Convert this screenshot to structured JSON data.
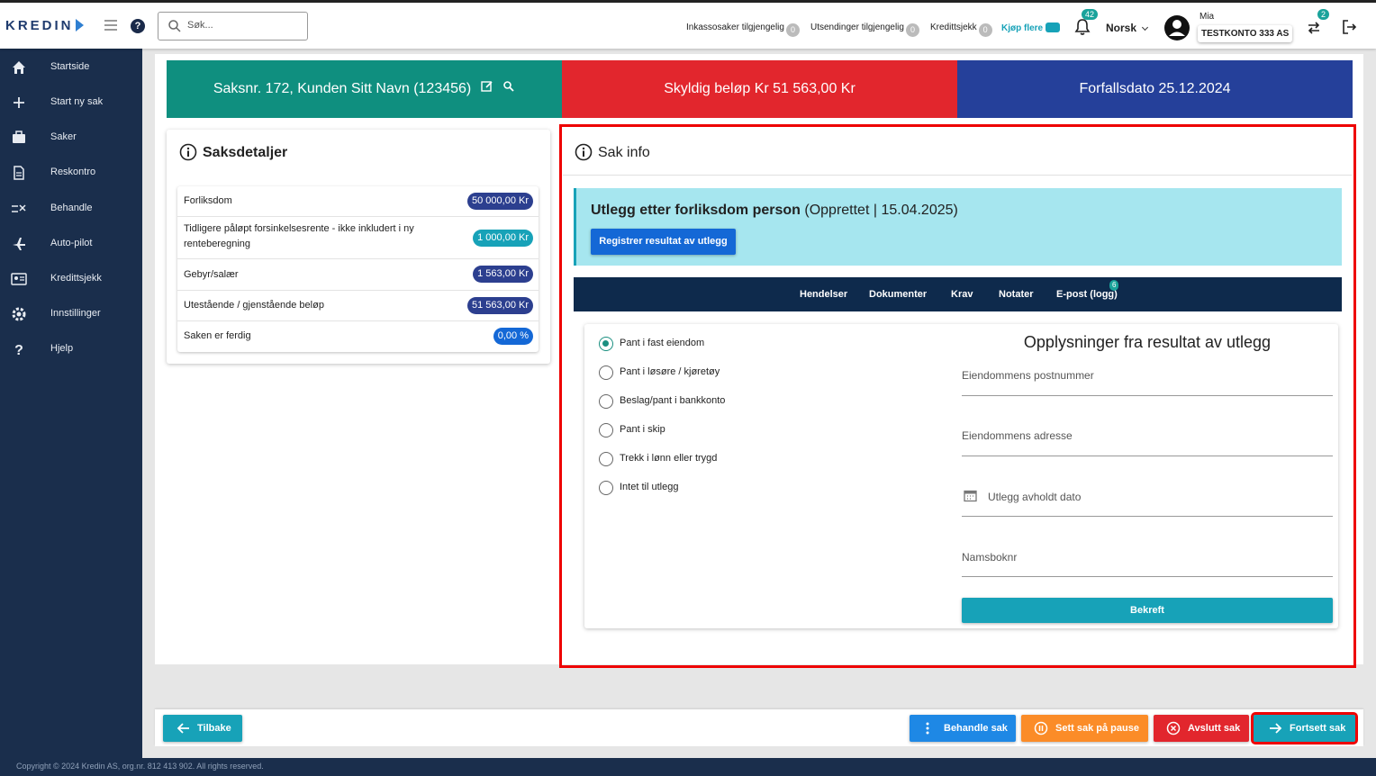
{
  "topbar": {
    "logo": "KREDIN",
    "search_placeholder": "Søk...",
    "stats": [
      {
        "label": "Inkassosaker tilgjengelig",
        "count": "0"
      },
      {
        "label": "Utsendinger tilgjengelig",
        "count": "0"
      },
      {
        "label": "Kredittsjekk",
        "count": "0"
      }
    ],
    "buy_more": "Kjøp flere",
    "notifications_count": "42",
    "language": "Norsk",
    "user_name": "Mia",
    "account": "TESTKONTO 333 AS",
    "switch_count": "2"
  },
  "sidebar": {
    "items": [
      {
        "label": "Startside",
        "icon": "home-icon"
      },
      {
        "label": "Start ny sak",
        "icon": "plus-icon"
      },
      {
        "label": "Saker",
        "icon": "briefcase-icon"
      },
      {
        "label": "Reskontro",
        "icon": "document-icon"
      },
      {
        "label": "Behandle",
        "icon": "checklist-icon"
      },
      {
        "label": "Auto-pilot",
        "icon": "airplane-icon"
      },
      {
        "label": "Kredittsjekk",
        "icon": "id-card-icon"
      },
      {
        "label": "Innstillinger",
        "icon": "gear-icon"
      },
      {
        "label": "Hjelp",
        "icon": "question-icon"
      }
    ]
  },
  "header": {
    "case": "Saksnr. 172,  Kunden Sitt Navn (123456)",
    "owed": "Skyldig beløp Kr 51 563,00 Kr",
    "due": "Forfallsdato  25.12.2024"
  },
  "details": {
    "title": "Saksdetaljer",
    "rows": [
      {
        "label": "Forliksdom",
        "value": "50 000,00 Kr",
        "color": "#2c3f8f"
      },
      {
        "label": "Tidligere påløpt forsinkelsesrente - ikke inkludert i ny renteberegning",
        "value": "1 000,00 Kr",
        "color": "#17a2b8"
      },
      {
        "label": "Gebyr/salær",
        "value": "1 563,00 Kr",
        "color": "#2c3f8f"
      },
      {
        "label": "Utestående / gjenstående beløp",
        "value": "51 563,00 Kr",
        "color": "#2c3f8f"
      },
      {
        "label": "Saken er ferdig",
        "value": "0,00 %",
        "color": "#1468d6"
      }
    ]
  },
  "sak": {
    "title": "Sak info",
    "utlegg_title": "Utlegg etter forliksdom person",
    "utlegg_status": " (Opprettet | 15.04.2025)",
    "register_button": "Registrer resultat av utlegg",
    "tabs": [
      "Hendelser",
      "Dokumenter",
      "Krav",
      "Notater",
      "E-post (logg)"
    ],
    "email_count": "6",
    "options": [
      {
        "label": "Pant i fast eiendom",
        "selected": true
      },
      {
        "label": "Pant i løsøre / kjøretøy",
        "selected": false
      },
      {
        "label": "Beslag/pant i bankkonto",
        "selected": false
      },
      {
        "label": "Pant i skip",
        "selected": false
      },
      {
        "label": "Trekk i lønn eller trygd",
        "selected": false
      },
      {
        "label": "Intet til utlegg",
        "selected": false
      }
    ],
    "result_title": "Opplysninger fra resultat av utlegg",
    "fields": {
      "postnr": "Eiendommens postnummer",
      "adresse": "Eiendommens adresse",
      "dato": "Utlegg avholdt dato",
      "namsboknr": "Namsboknr"
    },
    "confirm_button": "Bekreft"
  },
  "bottom": {
    "back": "Tilbake",
    "handle": "Behandle sak",
    "pause": "Sett sak på pause",
    "close": "Avslutt sak",
    "continue": "Fortsett sak"
  },
  "footer": "Copyright © 2024 Kredin AS, org.nr. 812 413 902. All rights reserved."
}
